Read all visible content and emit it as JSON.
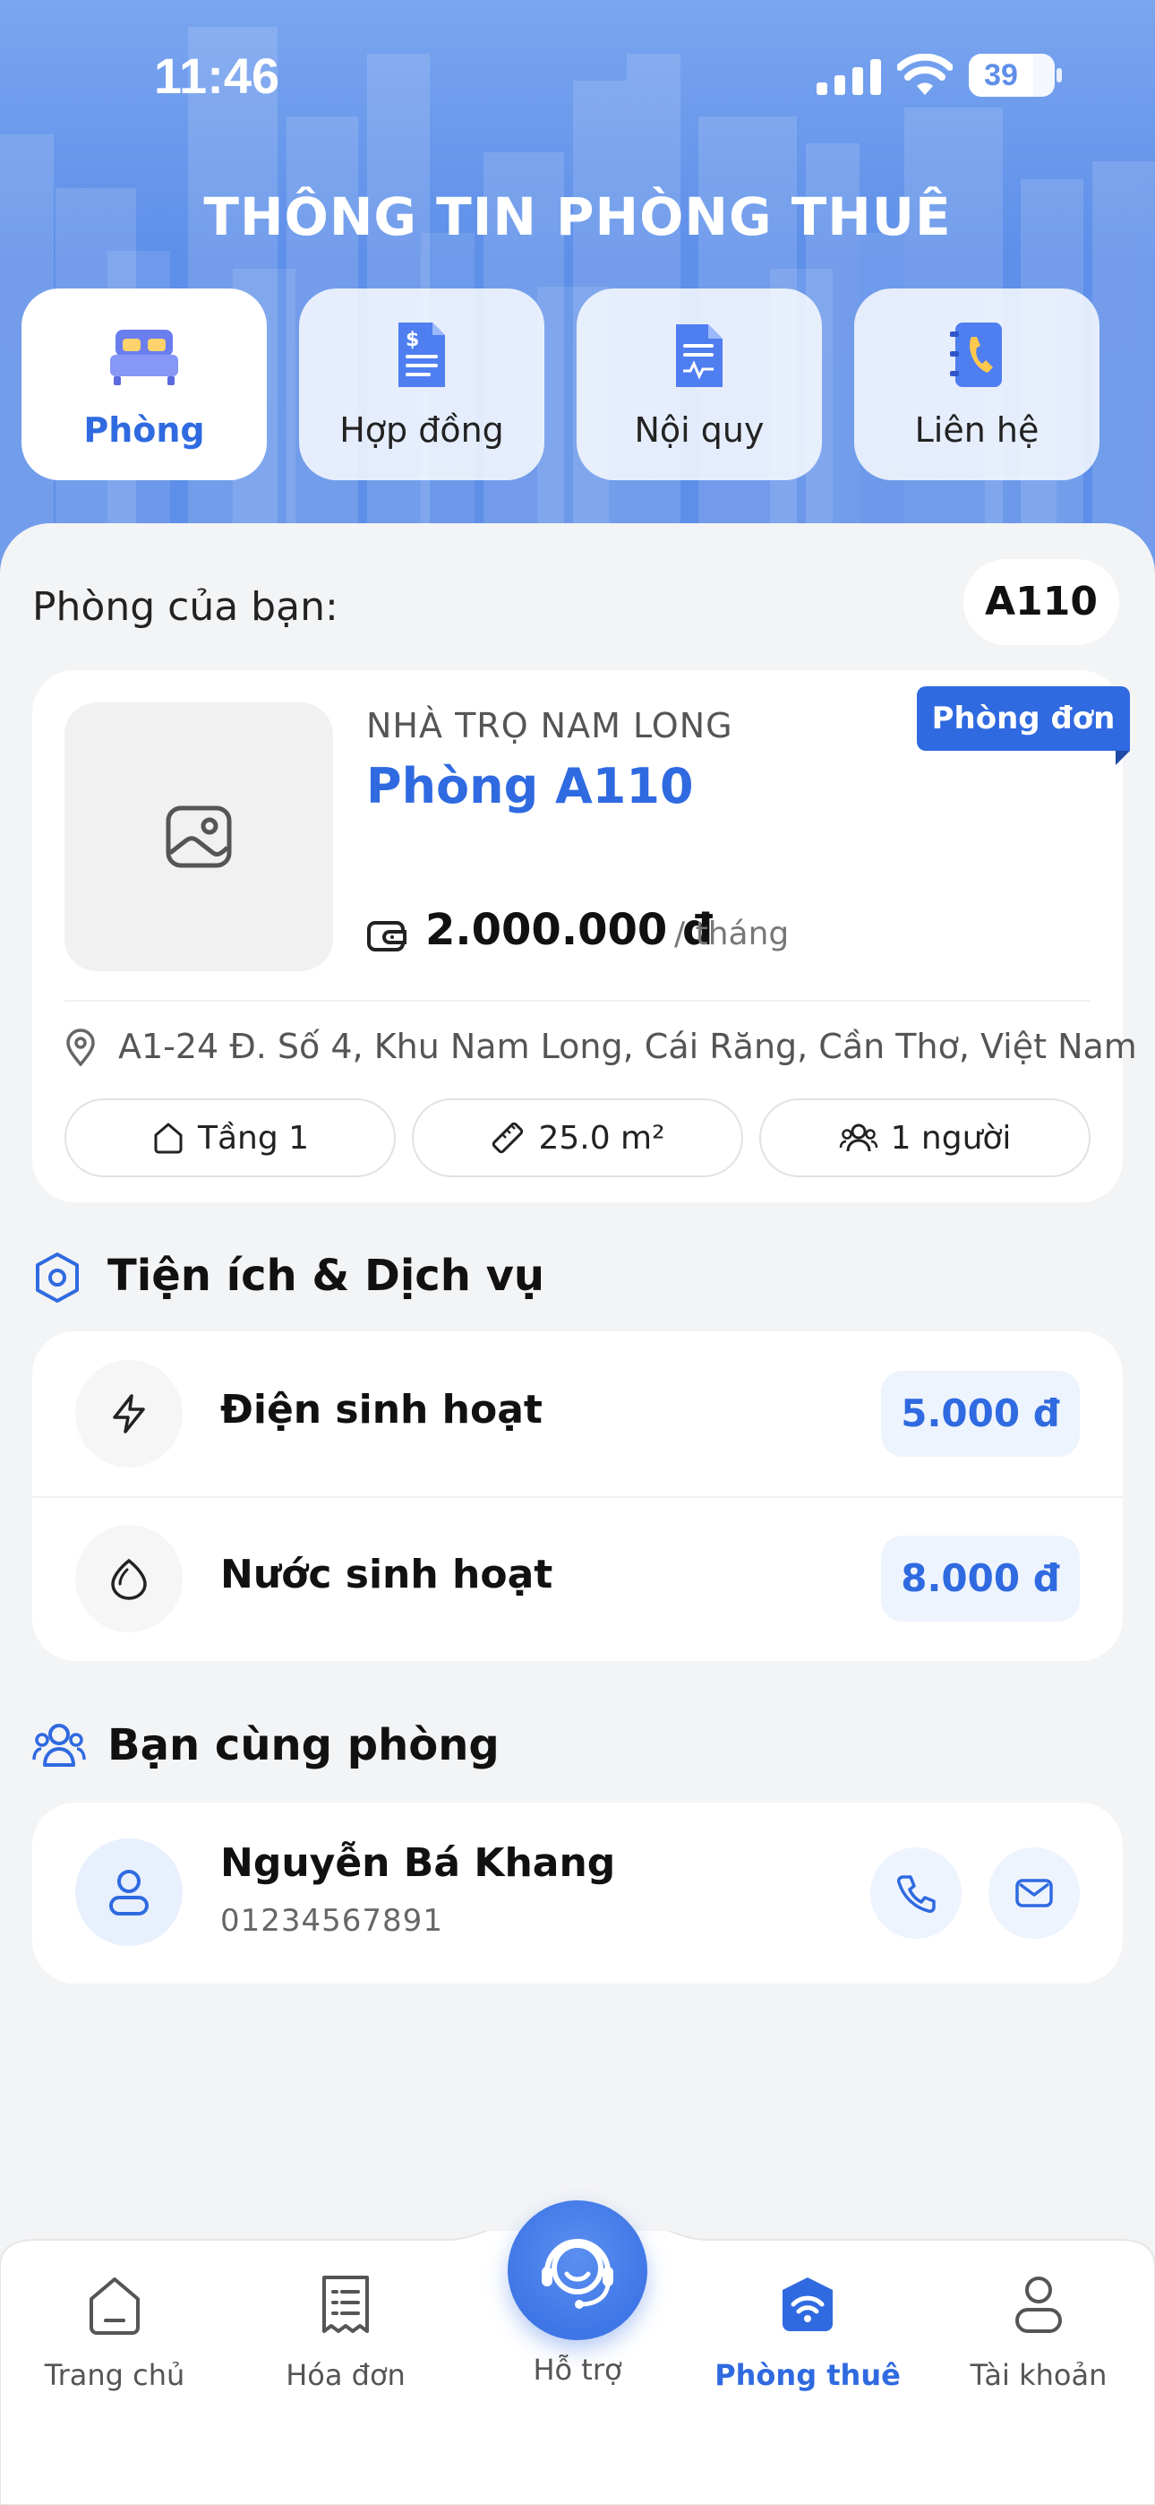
{
  "status_bar": {
    "time": "11:46",
    "battery": "39"
  },
  "header": {
    "title": "THÔNG TIN PHÒNG THUÊ"
  },
  "tabs": [
    {
      "label": "Phòng",
      "icon": "bed-icon",
      "active": true
    },
    {
      "label": "Hợp đồng",
      "icon": "contract-document-icon",
      "active": false
    },
    {
      "label": "Nội quy",
      "icon": "rules-document-icon",
      "active": false
    },
    {
      "label": "Liên hệ",
      "icon": "contact-book-icon",
      "active": false
    }
  ],
  "room_selector": {
    "label": "Phòng của bạn:",
    "value": "A110"
  },
  "room_card": {
    "badge": "Phòng đơn",
    "house_name": "NHÀ TRỌ NAM LONG",
    "room_name": "Phòng A110",
    "price": "2.000.000 đ",
    "price_unit": "/ tháng",
    "address": "A1-24 Đ. Số 4, Khu Nam Long, Cái Răng, Cần Thơ, Việt Nam",
    "stats": [
      {
        "icon": "floor-house-icon",
        "text": "Tầng 1"
      },
      {
        "icon": "ruler-icon",
        "text": "25.0 m²"
      },
      {
        "icon": "people-icon",
        "text": "1 người"
      }
    ]
  },
  "services": {
    "title": "Tiện ích & Dịch vụ",
    "items": [
      {
        "icon": "lightning-icon",
        "name": "Điện sinh hoạt",
        "price": "5.000 đ"
      },
      {
        "icon": "water-drop-icon",
        "name": "Nước sinh hoạt",
        "price": "8.000 đ"
      }
    ]
  },
  "roommates": {
    "title": "Bạn cùng phòng",
    "items": [
      {
        "name": "Nguyễn Bá Khang",
        "phone": "01234567891"
      }
    ]
  },
  "bottom_nav": [
    {
      "label": "Trang chủ",
      "icon": "home-icon",
      "active": false
    },
    {
      "label": "Hóa đơn",
      "icon": "invoice-icon",
      "active": false
    },
    {
      "label": "Hỗ trợ",
      "icon": "support-headset-icon",
      "active": false
    },
    {
      "label": "Phòng thuê",
      "icon": "rented-room-icon",
      "active": true
    },
    {
      "label": "Tài khoản",
      "icon": "account-icon",
      "active": false
    }
  ],
  "colors": {
    "accent": "#2f6ae0",
    "header_top": "#7aa5ef",
    "header_bottom": "#5d8ee8",
    "background": "#f3f4f6"
  }
}
